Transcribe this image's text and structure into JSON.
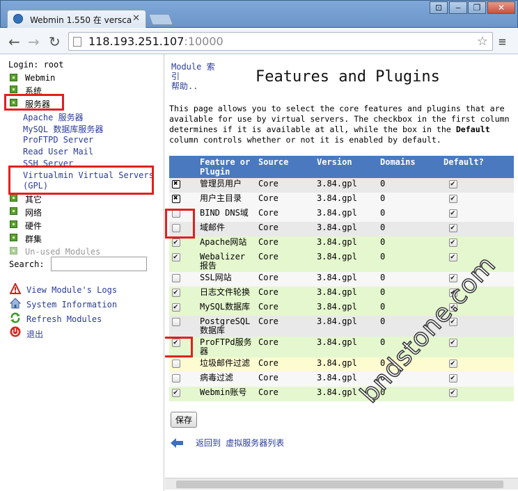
{
  "browser": {
    "tab_title": "Webmin 1.550 在 versca",
    "url_host": "118.193.251.107",
    "url_port": ":10000",
    "window_buttons": {
      "user": "⊡",
      "minimize": "‒",
      "restore": "❐",
      "close": "✕"
    }
  },
  "sidebar": {
    "login": "Login: root",
    "categories": [
      {
        "label": "Webmin"
      },
      {
        "label": "系统"
      },
      {
        "label": "服务器"
      }
    ],
    "server_modules": [
      "Apache 服务器",
      "MySQL 数据库服务器",
      "ProFTPD Server",
      "Read User Mail",
      "SSH Server",
      "Virtualmin Virtual Servers",
      "(GPL)"
    ],
    "more_categories": [
      "其它",
      "网络",
      "硬件",
      "群集"
    ],
    "unused": "Un-used Modules",
    "search_label": "Search:",
    "links": [
      {
        "label": "View Module's Logs",
        "icon": "warning-icon"
      },
      {
        "label": "System Information",
        "icon": "home-icon"
      },
      {
        "label": "Refresh Modules",
        "icon": "refresh-icon"
      },
      {
        "label": "退出",
        "icon": "power-icon"
      }
    ]
  },
  "main": {
    "module_index": [
      "Module 索",
      "引",
      "帮助.."
    ],
    "title": "Features and Plugins",
    "description": "This page allows you to select the core features and plugins that are available for use by virtual servers. The checkbox in the first column determines if it is available at all, while the box in the",
    "description_bold": "Default",
    "description_tail": "column controls whether or not it is enabled by default.",
    "columns": [
      "Feature or Plugin",
      "Source",
      "Version",
      "Domains",
      "Default?"
    ],
    "rows": [
      {
        "feature": "管理员用户",
        "source": "Core",
        "version": "3.84.gpl",
        "domains": "0",
        "enabled": "locked",
        "default": true,
        "bg": "gray"
      },
      {
        "feature": "用户主目录",
        "source": "Core",
        "version": "3.84.gpl",
        "domains": "0",
        "enabled": "locked",
        "default": true,
        "bg": "white"
      },
      {
        "feature": "BIND DNS域",
        "source": "Core",
        "version": "3.84.gpl",
        "domains": "0",
        "enabled": "off",
        "default": true,
        "bg": "white"
      },
      {
        "feature": "域邮件",
        "source": "Core",
        "version": "3.84.gpl",
        "domains": "0",
        "enabled": "off",
        "default": true,
        "bg": "gray"
      },
      {
        "feature": "Apache网站",
        "source": "Core",
        "version": "3.84.gpl",
        "domains": "0",
        "enabled": "on",
        "default": true,
        "bg": "green"
      },
      {
        "feature": "Webalizer报告",
        "source": "Core",
        "version": "3.84.gpl",
        "domains": "0",
        "enabled": "on",
        "default": true,
        "bg": "green"
      },
      {
        "feature": "SSL网站",
        "source": "Core",
        "version": "3.84.gpl",
        "domains": "0",
        "enabled": "off",
        "default": true,
        "bg": "white"
      },
      {
        "feature": "日志文件轮换",
        "source": "Core",
        "version": "3.84.gpl",
        "domains": "0",
        "enabled": "on",
        "default": true,
        "bg": "green"
      },
      {
        "feature": "MySQL数据库",
        "source": "Core",
        "version": "3.84.gpl",
        "domains": "0",
        "enabled": "on",
        "default": true,
        "bg": "green"
      },
      {
        "feature": "PostgreSQL数据库",
        "source": "Core",
        "version": "3.84.gpl",
        "domains": "0",
        "enabled": "off",
        "default": true,
        "bg": "gray"
      },
      {
        "feature": "ProFTPd服务器",
        "source": "Core",
        "version": "3.84.gpl",
        "domains": "0",
        "enabled": "on",
        "default": true,
        "bg": "green"
      },
      {
        "feature": "垃圾邮件过滤",
        "source": "Core",
        "version": "3.84.gpl",
        "domains": "0",
        "enabled": "off",
        "default": true,
        "bg": "yellow"
      },
      {
        "feature": "病毒过滤",
        "source": "Core",
        "version": "3.84.gpl",
        "domains": "0",
        "enabled": "off",
        "default": true,
        "bg": "white"
      },
      {
        "feature": "Webmin账号",
        "source": "Core",
        "version": "3.84.gpl",
        "domains": "0",
        "enabled": "on",
        "default": true,
        "bg": "green"
      }
    ],
    "save": "保存",
    "back": "返回到  虚拟服务器列表"
  },
  "watermark": "bndstone.com",
  "colors": {
    "header": "#4a79c0",
    "link": "#2a3c9a",
    "highlight": "#e02020",
    "green_row": "#e5f7ce"
  }
}
